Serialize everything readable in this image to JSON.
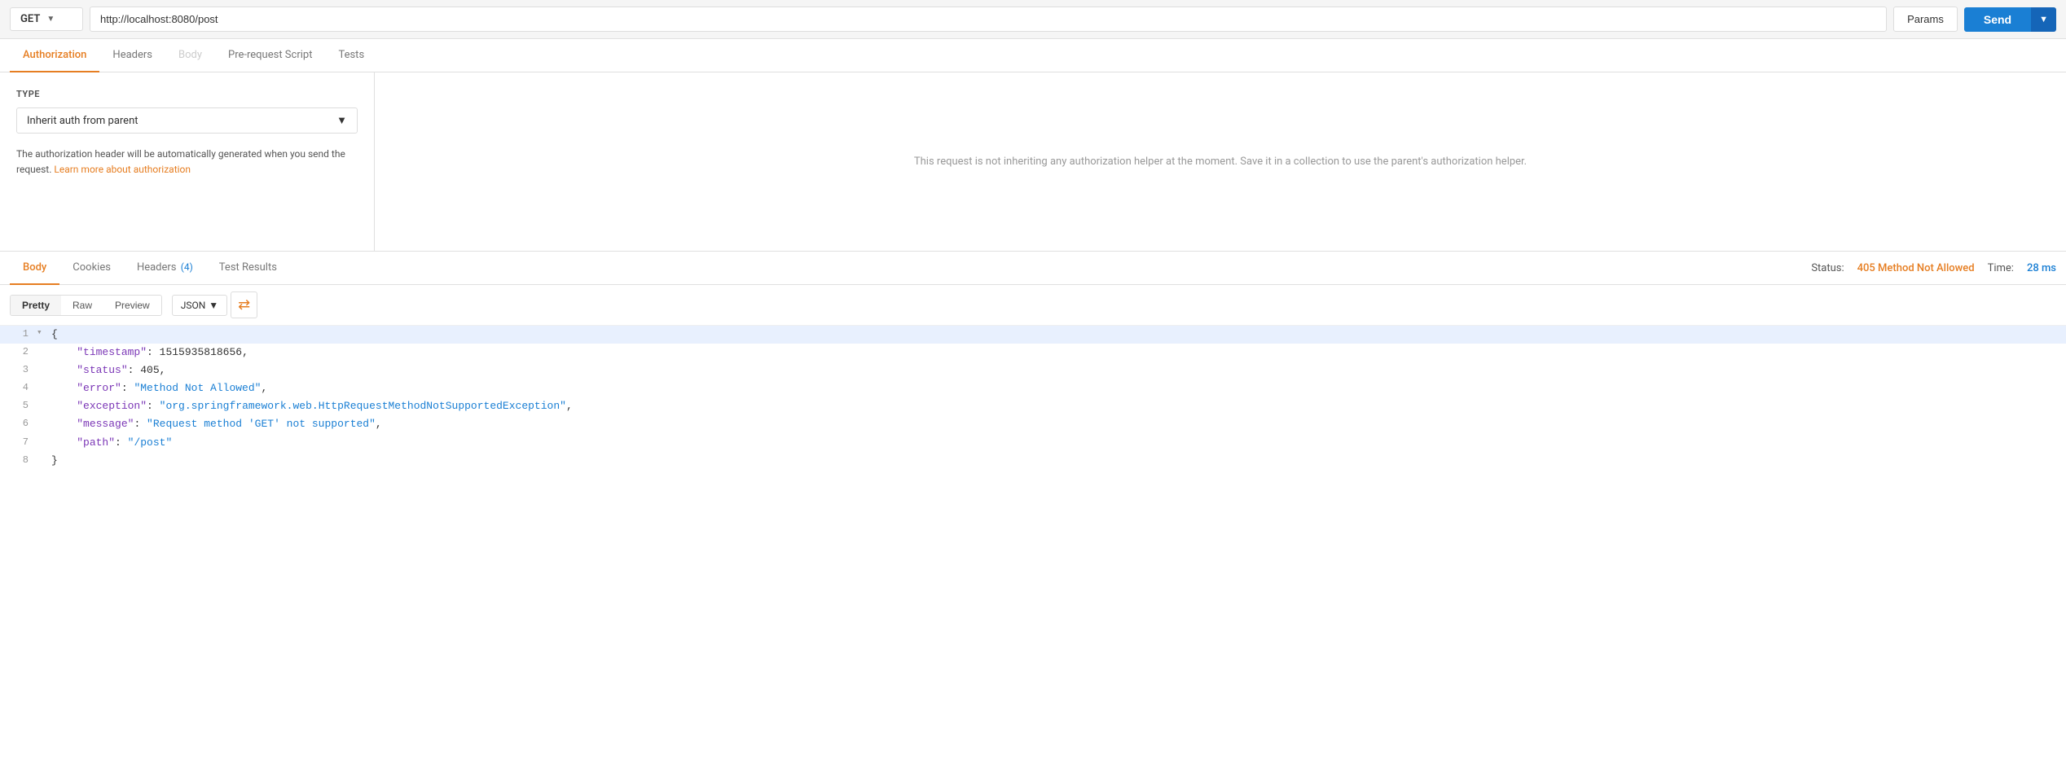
{
  "topbar": {
    "method": "GET",
    "url": "http://localhost:8080/post",
    "params_label": "Params",
    "send_label": "Send"
  },
  "request_tabs": [
    {
      "id": "authorization",
      "label": "Authorization",
      "active": true,
      "disabled": false
    },
    {
      "id": "headers",
      "label": "Headers",
      "active": false,
      "disabled": false
    },
    {
      "id": "body",
      "label": "Body",
      "active": false,
      "disabled": true
    },
    {
      "id": "pre-request",
      "label": "Pre-request Script",
      "active": false,
      "disabled": false
    },
    {
      "id": "tests",
      "label": "Tests",
      "active": false,
      "disabled": false
    }
  ],
  "auth": {
    "type_label": "TYPE",
    "select_value": "Inherit auth from parent",
    "note_text": "The authorization header will be automatically generated when you send the request.",
    "link_text": "Learn more about authorization",
    "info_text": "This request is not inheriting any authorization helper at the moment. Save it in a collection to use the parent's authorization helper."
  },
  "response_tabs": [
    {
      "id": "body",
      "label": "Body",
      "active": true,
      "badge": null
    },
    {
      "id": "cookies",
      "label": "Cookies",
      "active": false,
      "badge": null
    },
    {
      "id": "headers",
      "label": "Headers",
      "active": false,
      "badge": "(4)"
    },
    {
      "id": "test-results",
      "label": "Test Results",
      "active": false,
      "badge": null
    }
  ],
  "response_meta": {
    "status_label": "Status:",
    "status_value": "405 Method Not Allowed",
    "time_label": "Time:",
    "time_value": "28 ms"
  },
  "response_toolbar": {
    "format_tabs": [
      {
        "id": "pretty",
        "label": "Pretty",
        "active": true
      },
      {
        "id": "raw",
        "label": "Raw",
        "active": false
      },
      {
        "id": "preview",
        "label": "Preview",
        "active": false
      }
    ],
    "json_select": "JSON",
    "wrap_icon": "≡"
  },
  "code": {
    "lines": [
      {
        "num": 1,
        "arrow": "▾",
        "highlighted": true,
        "content": "{",
        "type": "plain"
      },
      {
        "num": 2,
        "arrow": "",
        "highlighted": false,
        "content": null,
        "type": "kv",
        "key": "timestamp",
        "value": "1515935818656",
        "value_type": "num",
        "comma": true
      },
      {
        "num": 3,
        "arrow": "",
        "highlighted": false,
        "content": null,
        "type": "kv",
        "key": "status",
        "value": "405",
        "value_type": "num",
        "comma": true
      },
      {
        "num": 4,
        "arrow": "",
        "highlighted": false,
        "content": null,
        "type": "kv",
        "key": "error",
        "value": "\"Method Not Allowed\"",
        "value_type": "str",
        "comma": true
      },
      {
        "num": 5,
        "arrow": "",
        "highlighted": false,
        "content": null,
        "type": "kv",
        "key": "exception",
        "value": "\"org.springframework.web.HttpRequestMethodNotSupportedException\"",
        "value_type": "str",
        "comma": true
      },
      {
        "num": 6,
        "arrow": "",
        "highlighted": false,
        "content": null,
        "type": "kv",
        "key": "message",
        "value": "\"Request method 'GET' not supported\"",
        "value_type": "str",
        "comma": true
      },
      {
        "num": 7,
        "arrow": "",
        "highlighted": false,
        "content": null,
        "type": "kv",
        "key": "path",
        "value": "\"/post\"",
        "value_type": "str",
        "comma": false
      },
      {
        "num": 8,
        "arrow": "",
        "highlighted": false,
        "content": "}",
        "type": "plain"
      }
    ]
  }
}
